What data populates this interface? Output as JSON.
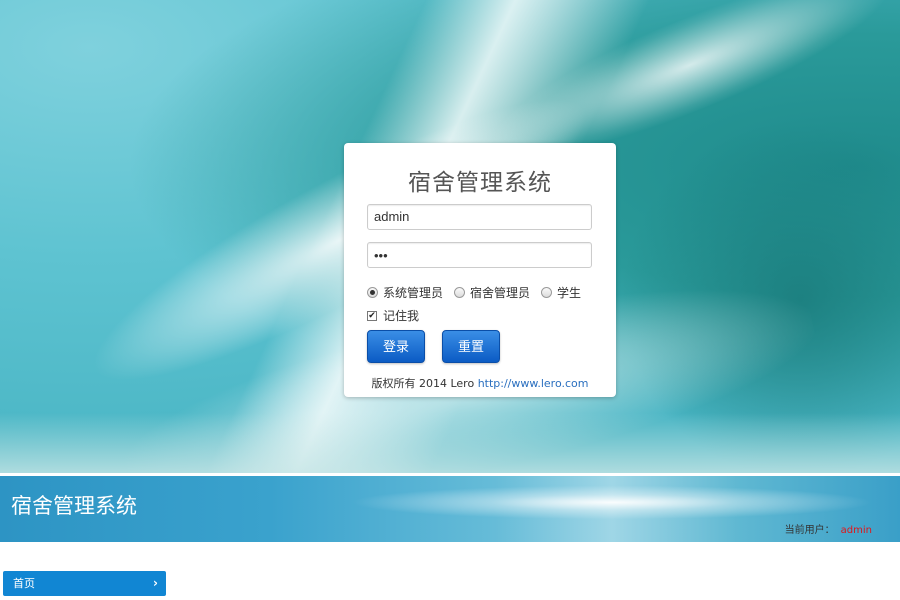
{
  "login": {
    "title": "宿舍管理系统",
    "username_value": "admin",
    "password_mask": "•••",
    "roles": [
      {
        "label": "系统管理员",
        "selected": true
      },
      {
        "label": "宿舍管理员",
        "selected": false
      },
      {
        "label": "学生",
        "selected": false
      }
    ],
    "remember_label": "记住我",
    "remember_checked": true,
    "login_button": "登录",
    "reset_button": "重置",
    "copyright_text": "版权所有 2014 Lero",
    "copyright_link": "http://www.lero.com"
  },
  "header": {
    "title": "宿舍管理系统",
    "current_user_label": "当前用户：",
    "current_user": "admin",
    "user_color": "#e0161a"
  },
  "nav": {
    "home_label": "首页",
    "home_icon": "chevron-right-icon"
  }
}
